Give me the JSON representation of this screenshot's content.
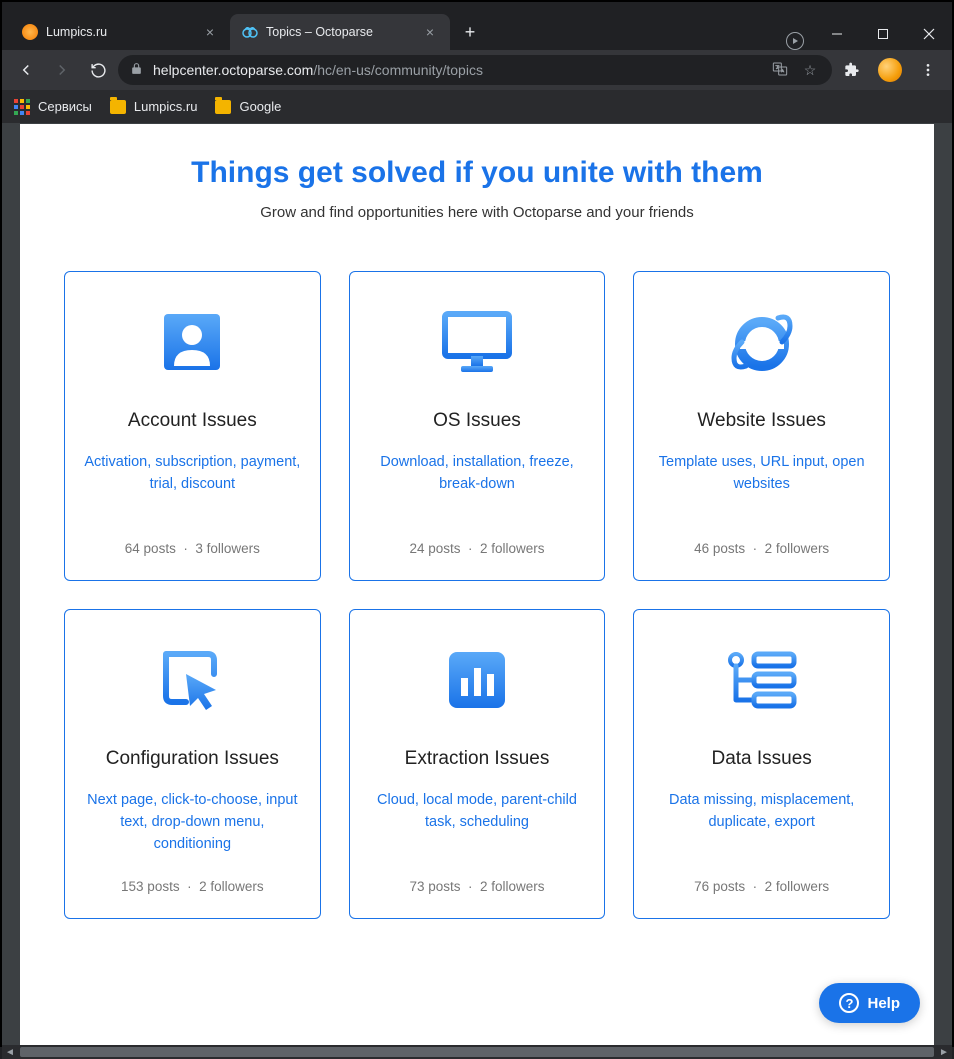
{
  "browser": {
    "tabs": [
      {
        "title": "Lumpics.ru",
        "active": false
      },
      {
        "title": "Topics – Octoparse",
        "active": true
      }
    ],
    "url_domain": "helpcenter.octoparse.com",
    "url_path": "/hc/en-us/community/topics",
    "bookmarks": {
      "apps": "Сервисы",
      "items": [
        "Lumpics.ru",
        "Google"
      ]
    }
  },
  "page": {
    "hero_title": "Things get solved if you unite with them",
    "hero_sub": "Grow and find opportunities here with Octoparse and your friends",
    "cards": [
      {
        "title": "Account Issues",
        "desc": "Activation, subscription, payment, trial, discount",
        "posts": "64 posts",
        "followers": "3 followers",
        "icon": "account"
      },
      {
        "title": "OS Issues",
        "desc": "Download, installation, freeze, break-down",
        "posts": "24 posts",
        "followers": "2 followers",
        "icon": "monitor"
      },
      {
        "title": "Website Issues",
        "desc": "Template uses, URL input, open websites",
        "posts": "46 posts",
        "followers": "2 followers",
        "icon": "ie"
      },
      {
        "title": "Configuration Issues",
        "desc": "Next page, click-to-choose, input text, drop-down menu, conditioning",
        "posts": "153 posts",
        "followers": "2 followers",
        "icon": "cursor"
      },
      {
        "title": "Extraction Issues",
        "desc": "Cloud, local mode, parent-child task, scheduling",
        "posts": "73 posts",
        "followers": "2 followers",
        "icon": "chart"
      },
      {
        "title": "Data Issues",
        "desc": "Data missing, misplacement, duplicate, export",
        "posts": "76 posts",
        "followers": "2 followers",
        "icon": "tree"
      }
    ],
    "help_label": "Help"
  }
}
